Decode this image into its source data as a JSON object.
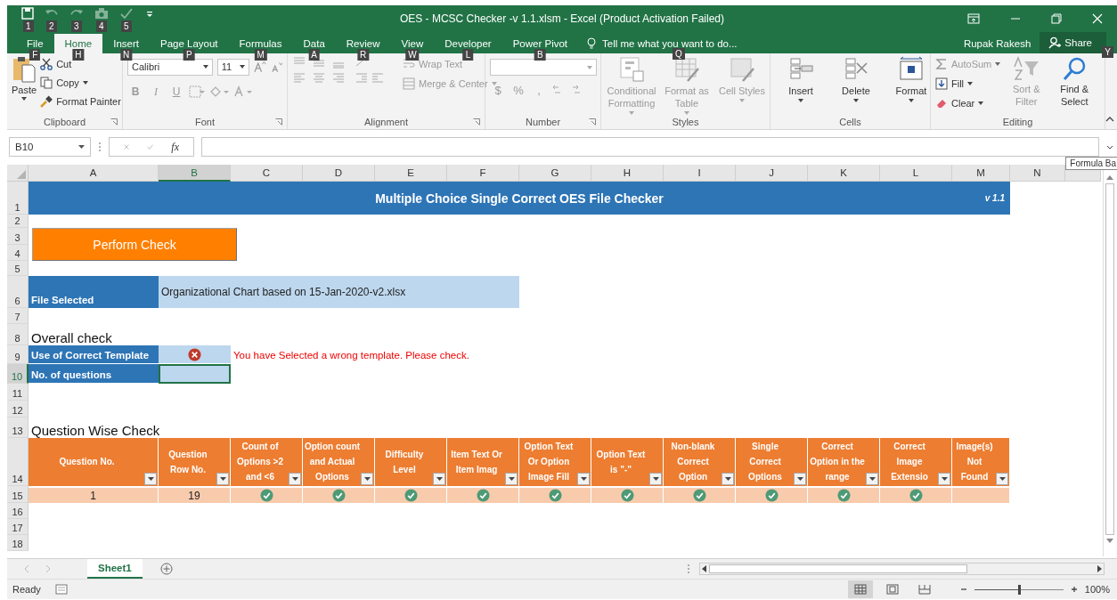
{
  "window": {
    "title": "OES - MCSC Checker -v 1.1.xlsm - Excel (Product Activation Failed)"
  },
  "quick_access": [
    {
      "kind": "save",
      "keytip": "1",
      "disabled": false
    },
    {
      "kind": "undo",
      "keytip": "2",
      "disabled": true
    },
    {
      "kind": "redo",
      "keytip": "3",
      "disabled": true
    },
    {
      "kind": "camera",
      "keytip": "4",
      "disabled": true
    },
    {
      "kind": "spelling",
      "keytip": "5",
      "disabled": true
    }
  ],
  "tabs": [
    {
      "label": "File",
      "keytip": "F",
      "selected": false
    },
    {
      "label": "Home",
      "keytip": "H",
      "selected": true
    },
    {
      "label": "Insert",
      "keytip": "N",
      "selected": false
    },
    {
      "label": "Page Layout",
      "keytip": "P",
      "selected": false
    },
    {
      "label": "Formulas",
      "keytip": "M",
      "selected": false
    },
    {
      "label": "Data",
      "keytip": "A",
      "selected": false
    },
    {
      "label": "Review",
      "keytip": "R",
      "selected": false
    },
    {
      "label": "View",
      "keytip": "W",
      "selected": false
    },
    {
      "label": "Developer",
      "keytip": "L",
      "selected": false
    },
    {
      "label": "Power Pivot",
      "keytip": "B",
      "selected": false
    }
  ],
  "tell_me": {
    "placeholder": "Tell me what you want to do...",
    "keytip": "Q"
  },
  "user": "Rupak Rakesh",
  "share": {
    "label": "Share",
    "keytip": "Y"
  },
  "ribbon": {
    "clipboard": {
      "label": "Clipboard",
      "paste": {
        "label": "Paste",
        "disabled": false
      },
      "cut": {
        "label": "Cut",
        "disabled": false
      },
      "copy": {
        "label": "Copy",
        "disabled": false
      },
      "format_painter": {
        "label": "Format Painter",
        "disabled": false
      }
    },
    "font": {
      "label": "Font",
      "font_name": "Calibri",
      "font_size": "11",
      "bold": {
        "label": "B",
        "disabled": true
      },
      "italic": {
        "label": "I",
        "disabled": true
      },
      "underline": {
        "label": "U",
        "disabled": true
      }
    },
    "alignment": {
      "label": "Alignment",
      "wrap_text": {
        "label": "Wrap Text",
        "disabled": true
      },
      "merge_center": {
        "label": "Merge & Center",
        "disabled": true
      }
    },
    "number": {
      "label": "Number",
      "currency": {
        "label": "$",
        "disabled": true
      },
      "percent": {
        "label": "%",
        "disabled": true
      },
      "comma": {
        "label": ",",
        "disabled": true
      }
    },
    "styles": {
      "label": "Styles",
      "items": [
        {
          "kind": "conditional",
          "label": "Conditional Formatting",
          "disabled": true
        },
        {
          "kind": "table",
          "label": "Format as Table",
          "disabled": true
        },
        {
          "kind": "cellstyles",
          "label": "Cell Styles",
          "disabled": true
        }
      ]
    },
    "cells": {
      "label": "Cells",
      "items": [
        {
          "kind": "insert",
          "label": "Insert",
          "disabled": false
        },
        {
          "kind": "delete",
          "label": "Delete",
          "disabled": false
        },
        {
          "kind": "format",
          "label": "Format",
          "disabled": false
        }
      ]
    },
    "editing": {
      "label": "Editing",
      "autosum": {
        "label": "AutoSum",
        "disabled": true
      },
      "fill": {
        "label": "Fill",
        "disabled": false
      },
      "clear": {
        "label": "Clear",
        "disabled": false
      },
      "sort_filter": {
        "label": "Sort & Filter",
        "disabled": true
      },
      "find_select": {
        "label": "Find & Select",
        "disabled": false
      }
    }
  },
  "formula_bar": {
    "name_box": "B10",
    "function_label": "fx",
    "tooltip": "Formula Ba"
  },
  "columns": [
    {
      "label": "A",
      "selected": false
    },
    {
      "label": "B",
      "selected": true
    },
    {
      "label": "C",
      "selected": false
    },
    {
      "label": "D",
      "selected": false
    },
    {
      "label": "E",
      "selected": false
    },
    {
      "label": "F",
      "selected": false
    },
    {
      "label": "G",
      "selected": false
    },
    {
      "label": "H",
      "selected": false
    },
    {
      "label": "I",
      "selected": false
    },
    {
      "label": "J",
      "selected": false
    },
    {
      "label": "K",
      "selected": false
    },
    {
      "label": "L",
      "selected": false
    },
    {
      "label": "M",
      "selected": false
    },
    {
      "label": "N",
      "selected": false
    }
  ],
  "rows": [
    {
      "label": "1",
      "selected": false
    },
    {
      "label": "2",
      "selected": false
    },
    {
      "label": "3",
      "selected": false
    },
    {
      "label": "4",
      "selected": false
    },
    {
      "label": "5",
      "selected": false
    },
    {
      "label": "6",
      "selected": false
    },
    {
      "label": "7",
      "selected": false
    },
    {
      "label": "8",
      "selected": false
    },
    {
      "label": "9",
      "selected": false
    },
    {
      "label": "10",
      "selected": true
    },
    {
      "label": "11",
      "selected": false
    },
    {
      "label": "12",
      "selected": false
    },
    {
      "label": "13",
      "selected": false
    },
    {
      "label": "14",
      "selected": false
    },
    {
      "label": "15",
      "selected": false
    },
    {
      "label": "16",
      "selected": false
    },
    {
      "label": "17",
      "selected": false
    },
    {
      "label": "18",
      "selected": false
    }
  ],
  "banner": {
    "title": "Multiple Choice Single Correct OES File Checker",
    "version": "v 1.1"
  },
  "perform_button": "Perform Check",
  "file_selected": {
    "label": "File Selected",
    "value": "Organizational Chart based on 15-Jan-2020-v2.xlsx"
  },
  "overall_check": {
    "heading": "Overall check",
    "items": [
      {
        "label": "Use of Correct Template",
        "passed": false,
        "message": "You have Selected a wrong template. Please check.",
        "selected": false
      },
      {
        "label": "No. of questions",
        "selected": true
      }
    ]
  },
  "question_check": {
    "heading": "Question Wise Check",
    "columns": [
      "Question No.",
      "Question Row No.",
      "Count of Options >2 and <6",
      "Option count and Actual Options",
      "Difficulty Level",
      "Item Text Or Item Imag",
      "Option Text Or Option Image Fill",
      "Option Text is \"-\"",
      "Non-blank Correct Option",
      "Single Correct Options",
      "Correct Option in the range",
      "Correct Image Extensio",
      "Image(s) Not Found"
    ],
    "rows": [
      {
        "cells": [
          {
            "kind": "text",
            "text": "1"
          },
          {
            "kind": "text",
            "text": "19"
          },
          {
            "kind": "pass"
          },
          {
            "kind": "pass"
          },
          {
            "kind": "pass"
          },
          {
            "kind": "pass"
          },
          {
            "kind": "pass"
          },
          {
            "kind": "pass"
          },
          {
            "kind": "pass"
          },
          {
            "kind": "pass"
          },
          {
            "kind": "pass"
          },
          {
            "kind": "pass"
          },
          {
            "kind": "blank"
          }
        ]
      }
    ]
  },
  "sheet_tabs": [
    {
      "label": "Sheet1",
      "selected": true
    }
  ],
  "status_bar": {
    "status": "Ready",
    "views": [
      {
        "kind": "normal",
        "selected": true
      },
      {
        "kind": "page_layout",
        "selected": false
      },
      {
        "kind": "page_break",
        "selected": false
      }
    ],
    "zoom": {
      "level": 0.5,
      "label": "100%"
    }
  }
}
